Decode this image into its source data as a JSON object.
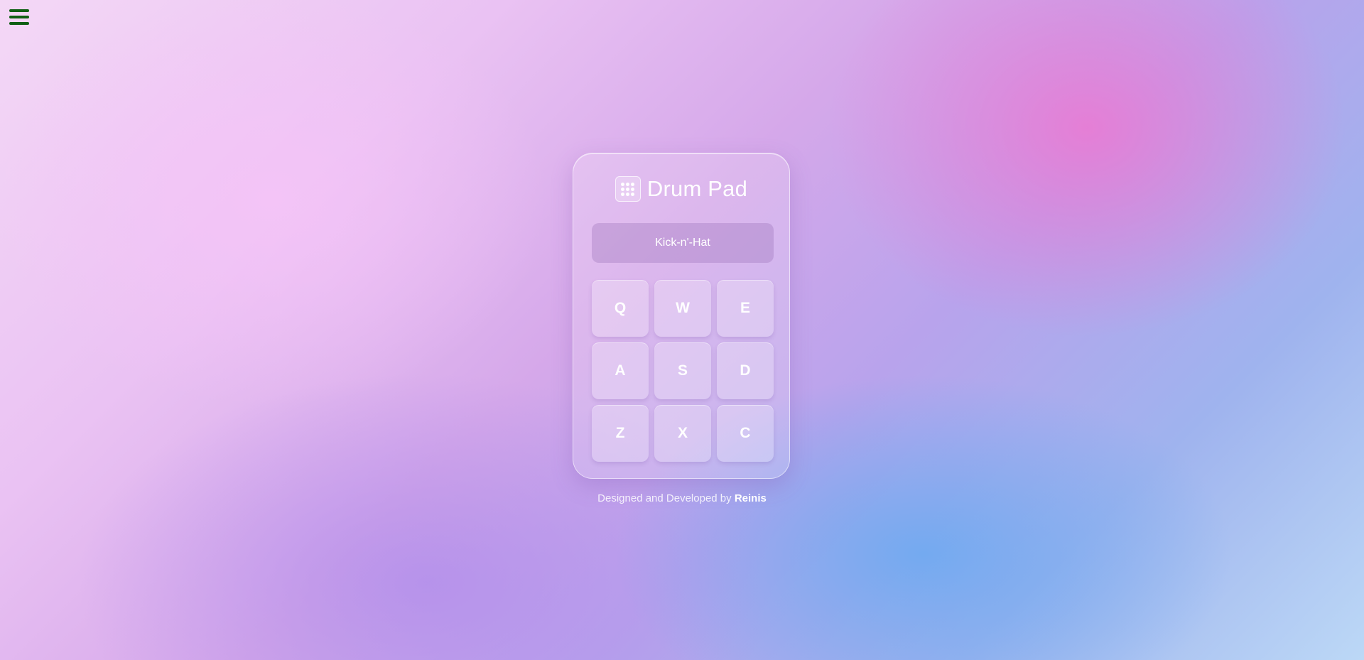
{
  "header": {
    "menu_icon": "hamburger-menu-icon"
  },
  "app": {
    "logo_icon": "grid-dots-icon",
    "title": "Drum Pad",
    "display_text": "Kick-n'-Hat",
    "pads": [
      "Q",
      "W",
      "E",
      "A",
      "S",
      "D",
      "Z",
      "X",
      "C"
    ]
  },
  "footer": {
    "prefix": "Designed and Developed by",
    "author": "Reinis"
  },
  "colors": {
    "menu_icon": "#0f5f14",
    "text": "#ffffff"
  }
}
